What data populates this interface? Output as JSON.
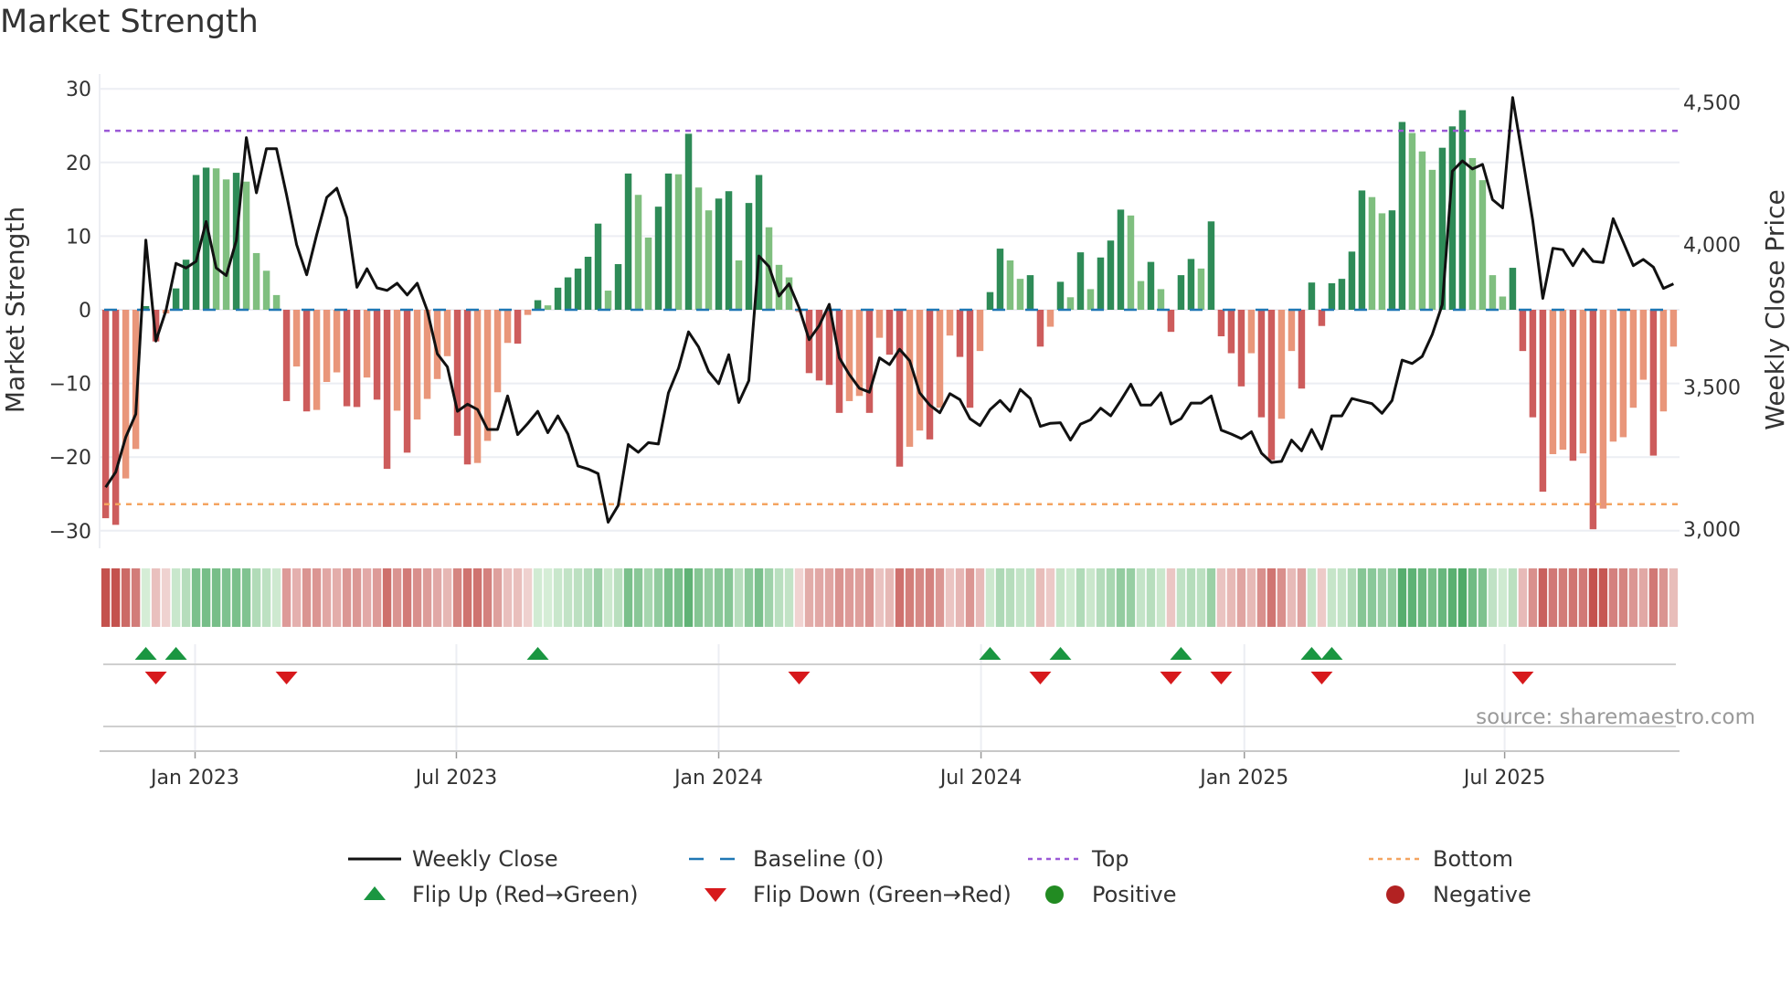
{
  "title": "Market Strength",
  "source": "source: sharemaestro.com",
  "colors": {
    "pos_strong": "#2e8b57",
    "pos_weak": "#7fbf7f",
    "neg_strong": "#cd5c5c",
    "neg_weak": "#e9967a",
    "close": "#111111",
    "baseline": "#1f77b4",
    "top": "#9b59d6",
    "bottom": "#f4a460",
    "flip_up": "#1a9641",
    "flip_down": "#d7191c",
    "positive": "#228b22",
    "negative": "#b22222"
  },
  "chart_data": {
    "type": "bar",
    "title": "Market Strength",
    "ylabel": "Market Strength",
    "ylabel_right": "Weekly Close Price",
    "ylim": [
      -31.5,
      32
    ],
    "ylim_right": [
      3000,
      4500
    ],
    "xlim": [
      0.4,
      157.6
    ],
    "yticks": [
      30,
      20,
      10,
      0,
      -10,
      -20,
      -30
    ],
    "ytick_labels": [
      "30",
      "20",
      "10",
      "0",
      "−10",
      "−20",
      "−30"
    ],
    "yticks_right": [
      4500,
      4000,
      3500,
      3000
    ],
    "ytick_right_labels": [
      "4,500",
      "4,000",
      "3,500",
      "3,000"
    ],
    "xticks": [
      9.9,
      35.9,
      62.0,
      88.1,
      114.3,
      140.2
    ],
    "xtick_labels": [
      "Jan 2023",
      "Jul 2023",
      "Jan 2024",
      "Jul 2024",
      "Jan 2025",
      "Jul 2025"
    ],
    "top_level": 24.3,
    "bottom_level": -26.4,
    "baseline": 0,
    "grid": true,
    "legend_placement": "bottom",
    "strength": [
      -28.3,
      -29.2,
      -22.9,
      -18.9,
      0.5,
      -4.3,
      -0.5,
      2.9,
      6.8,
      18.3,
      19.3,
      19.2,
      17.7,
      18.6,
      17.4,
      7.7,
      5.3,
      2.0,
      -12.4,
      -7.7,
      -13.8,
      -13.6,
      -9.8,
      -8.5,
      -13.1,
      -13.2,
      -9.2,
      -12.2,
      -21.6,
      -13.7,
      -19.4,
      -14.9,
      -12.1,
      -9.4,
      -6.3,
      -17.1,
      -21.0,
      -20.8,
      -17.8,
      -11.2,
      -4.5,
      -4.6,
      -0.7,
      1.3,
      0.6,
      3.0,
      4.4,
      5.6,
      7.2,
      11.7,
      2.6,
      6.2,
      18.5,
      15.6,
      9.8,
      14.0,
      18.5,
      18.4,
      23.9,
      16.6,
      13.5,
      15.1,
      16.1,
      6.7,
      14.5,
      18.3,
      11.2,
      6.1,
      4.4,
      -0.3,
      -8.6,
      -9.6,
      -10.2,
      -14.0,
      -12.4,
      -11.7,
      -14.0,
      -3.8,
      -6.1,
      -21.3,
      -18.6,
      -16.4,
      -17.6,
      -13.3,
      -3.5,
      -6.4,
      -13.3,
      -5.6,
      2.4,
      8.3,
      6.7,
      4.2,
      4.7,
      -5.0,
      -2.3,
      3.8,
      1.7,
      7.8,
      2.8,
      7.1,
      9.4,
      13.6,
      12.8,
      3.9,
      6.5,
      2.8,
      -3.0,
      4.7,
      6.9,
      5.6,
      12.0,
      -3.6,
      -5.9,
      -10.4,
      -5.9,
      -14.6,
      -20.4,
      -14.8,
      -5.6,
      -10.7,
      3.7,
      -2.2,
      3.6,
      4.2,
      7.9,
      16.2,
      15.3,
      13.1,
      13.5,
      25.5,
      24.0,
      21.5,
      19.0,
      22.0,
      24.9,
      27.1,
      20.6,
      17.6,
      4.7,
      1.8,
      5.7,
      -5.6,
      -14.6,
      -24.7,
      -19.6,
      -19.0,
      -20.5,
      -19.5,
      -29.8,
      -27.0,
      -17.9,
      -17.3,
      -13.3,
      -9.5,
      -19.8,
      -13.8,
      -5.0
    ],
    "strong": "DDLLDDLDDDDLLDLLLLDLDLLLDDLDDLDLLLLDDLLLLDLDLDDDDDLDDLLDDLDLLDDLDDLLLLDDDDLLDLDDLLDLLDDLDDLLDDLDLDLDDDLLDLDDDLDDDDLDDLLDDDDDDDLLDDLLLDDDLLLLDDDDLLDLDLLLLLDLL",
    "weekly_close": [
      3147,
      3200,
      3323,
      3404,
      4016,
      3661,
      3768,
      3934,
      3918,
      3941,
      4081,
      3918,
      3891,
      4014,
      4376,
      4182,
      4337,
      4337,
      4175,
      4000,
      3894,
      4035,
      4166,
      4198,
      4094,
      3850,
      3915,
      3848,
      3839,
      3864,
      3823,
      3864,
      3768,
      3616,
      3570,
      3414,
      3439,
      3420,
      3350,
      3350,
      3468,
      3332,
      3371,
      3414,
      3339,
      3398,
      3334,
      3222,
      3211,
      3195,
      3024,
      3083,
      3297,
      3270,
      3304,
      3299,
      3479,
      3565,
      3693,
      3640,
      3554,
      3511,
      3613,
      3445,
      3522,
      3960,
      3923,
      3819,
      3862,
      3778,
      3666,
      3715,
      3790,
      3602,
      3543,
      3495,
      3481,
      3602,
      3578,
      3632,
      3592,
      3479,
      3436,
      3409,
      3476,
      3455,
      3388,
      3364,
      3420,
      3452,
      3414,
      3491,
      3459,
      3361,
      3372,
      3374,
      3313,
      3369,
      3384,
      3425,
      3398,
      3452,
      3509,
      3436,
      3436,
      3479,
      3369,
      3388,
      3443,
      3443,
      3468,
      3348,
      3334,
      3318,
      3342,
      3267,
      3234,
      3238,
      3313,
      3275,
      3350,
      3281,
      3398,
      3398,
      3459,
      3450,
      3441,
      3407,
      3452,
      3594,
      3582,
      3607,
      3684,
      3789,
      4258,
      4294,
      4266,
      4282,
      4158,
      4129,
      4517,
      4303,
      4084,
      3811,
      3987,
      3982,
      3926,
      3984,
      3941,
      3937,
      4091,
      4009,
      3926,
      3948,
      3921,
      3846,
      3862
    ],
    "flip_up_weeks": [
      5,
      8,
      44,
      89,
      96,
      108,
      121,
      123
    ],
    "flip_down_weeks": [
      6,
      19,
      70,
      94,
      107,
      112,
      122,
      142
    ],
    "legend": [
      {
        "label": "Weekly Close",
        "kind": "line"
      },
      {
        "label": "Baseline (0)",
        "kind": "baseline"
      },
      {
        "label": "Top",
        "kind": "top"
      },
      {
        "label": "Bottom",
        "kind": "bottom"
      },
      {
        "label": "Flip Up (Red→Green)",
        "kind": "up"
      },
      {
        "label": "Flip Down (Green→Red)",
        "kind": "down"
      },
      {
        "label": "Positive",
        "kind": "pos"
      },
      {
        "label": "Negative",
        "kind": "neg"
      }
    ]
  }
}
